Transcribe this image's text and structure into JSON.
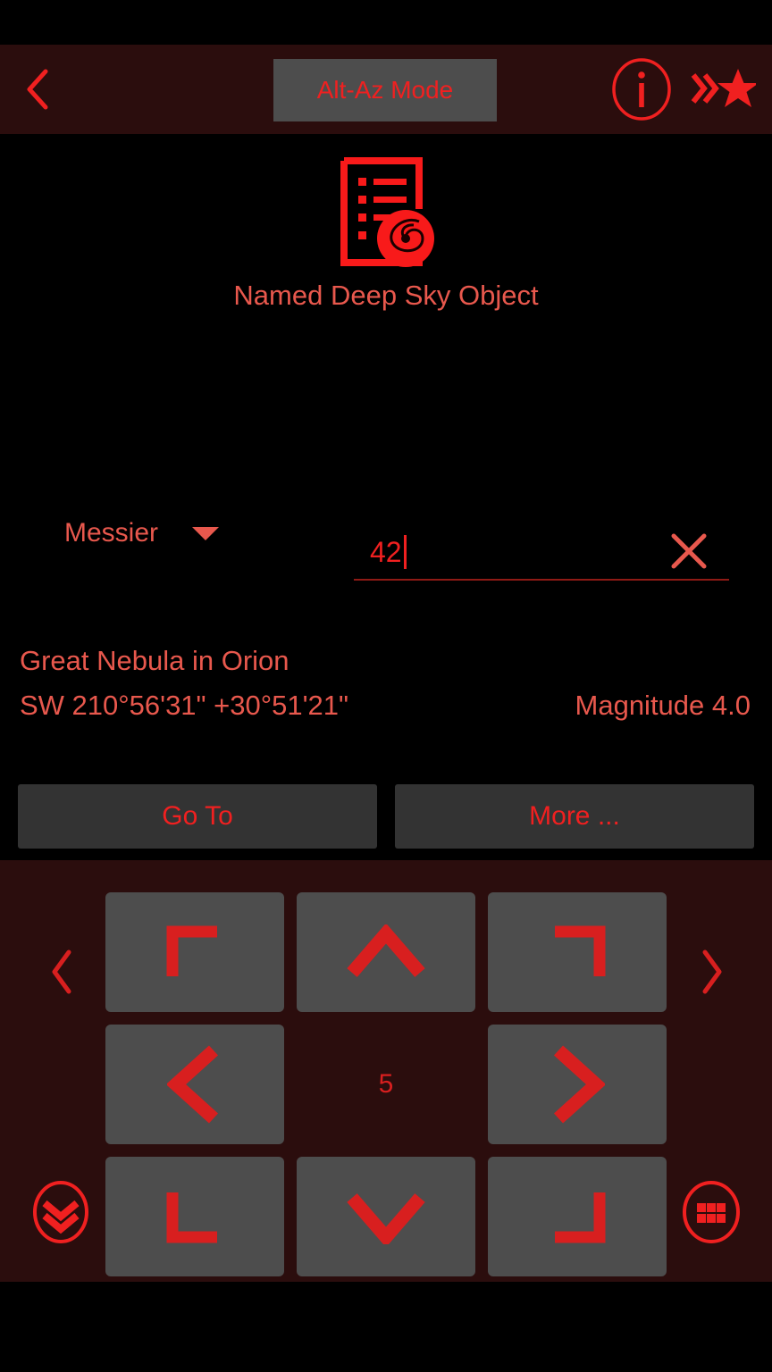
{
  "app_bar": {
    "back_icon": "chevron-left-icon",
    "mode_button_label": "Alt-Az Mode",
    "info_icon": "info-circle-icon",
    "favorites_icon": "double-chevron-star-icon"
  },
  "object": {
    "type_icon": "deep-sky-list-galaxy-icon",
    "type_label": "Named Deep Sky Object"
  },
  "search": {
    "catalog_label": "Messier",
    "catalog_caret_icon": "caret-down-icon",
    "query_value": "42",
    "query_placeholder": "",
    "clear_icon": "close-x-icon"
  },
  "result": {
    "name": "Great Nebula in Orion",
    "coordinates": "SW 210°56'31\" +30°51'21\"",
    "magnitude": "Magnitude 4.0"
  },
  "actions": {
    "goto_label": "Go To",
    "more_label": "More ..."
  },
  "control_pad": {
    "rate": "5",
    "left_arrow_icon": "chevron-left-icon",
    "right_arrow_icon": "chevron-right-icon",
    "collapse_icon": "double-chevron-down-circle-icon",
    "keypad_icon": "grid-dots-circle-icon",
    "buttons": [
      {
        "name": "up-left",
        "icon": "corner-up-left-icon"
      },
      {
        "name": "up",
        "icon": "chevron-up-icon"
      },
      {
        "name": "up-right",
        "icon": "corner-up-right-icon"
      },
      {
        "name": "left",
        "icon": "chevron-left-icon"
      },
      {
        "name": "rate",
        "icon": "rate-value"
      },
      {
        "name": "right",
        "icon": "chevron-right-icon"
      },
      {
        "name": "down-left",
        "icon": "corner-down-left-icon"
      },
      {
        "name": "down",
        "icon": "chevron-down-icon"
      },
      {
        "name": "down-right",
        "icon": "corner-down-right-icon"
      }
    ]
  },
  "colors": {
    "bright_red": "#f02020",
    "muted_red": "#e8584d",
    "pad_red": "#d81f1f",
    "panel_maroon": "#2b0d0d",
    "button_grey": "#4d4d4d",
    "action_grey": "#333333",
    "background": "#000000"
  }
}
